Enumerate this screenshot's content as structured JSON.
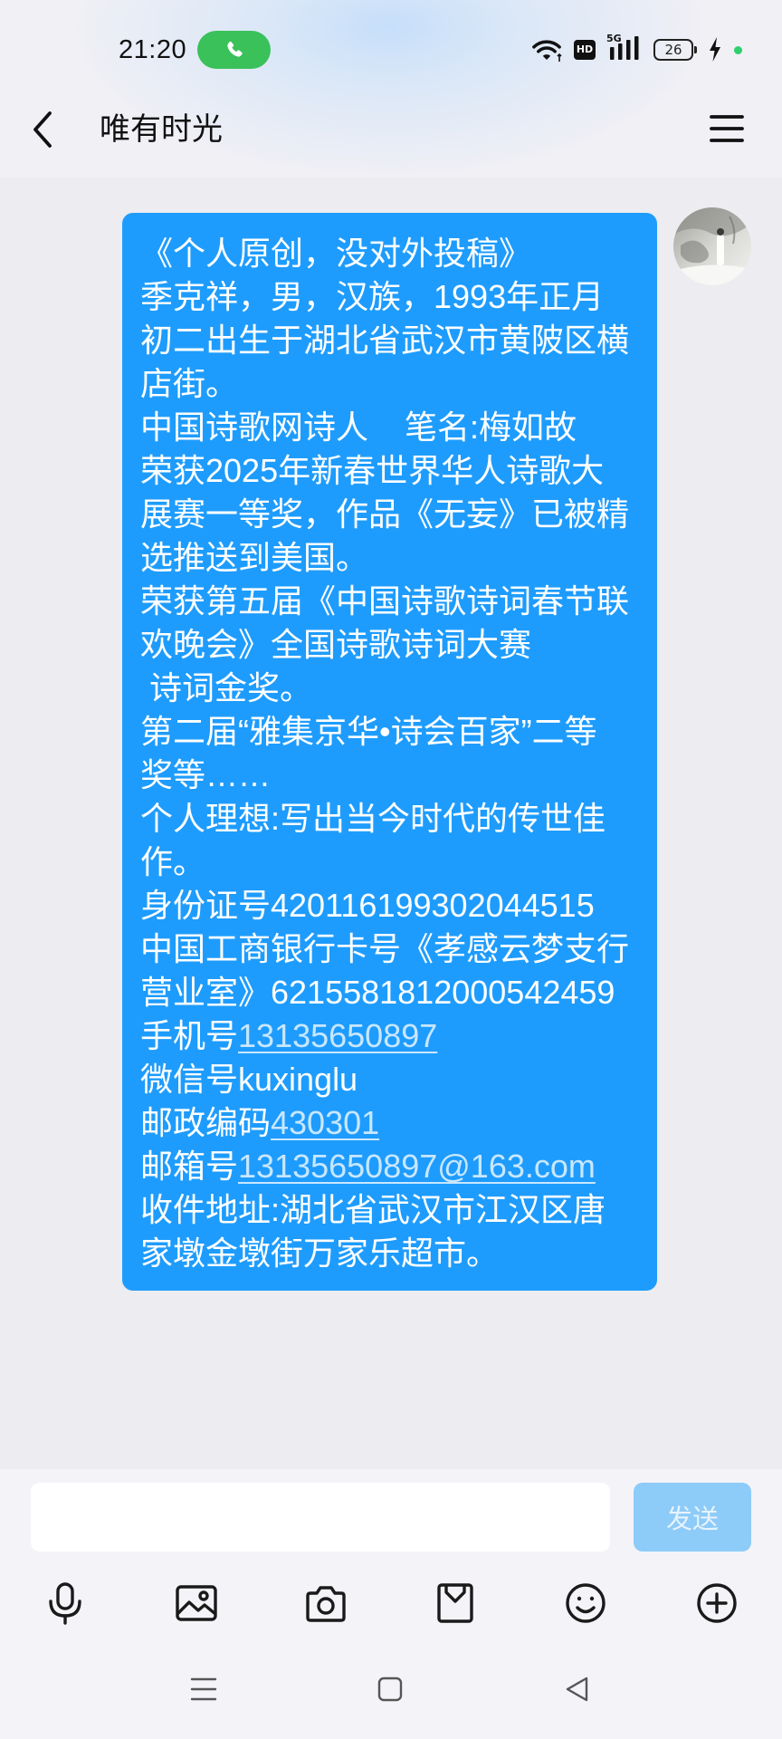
{
  "status_bar": {
    "time": "21:20",
    "call_icon": "phone-icon",
    "wifi_icon": "wifi-icon",
    "hd_label": "HD",
    "network_label": "5G",
    "battery_level": "26",
    "charging_icon": "bolt-icon",
    "call_color": "#3ac15a",
    "dot_color": "#2fd06d"
  },
  "header": {
    "back_icon": "chevron-left-icon",
    "title": "唯有时光",
    "menu_icon": "hamburger-menu-icon"
  },
  "conversation": {
    "messages": [
      {
        "lines": [
          {
            "text": "《个人原创，没对外投稿》"
          },
          {
            "text": "季克祥，男，汉族，1993年正月"
          },
          {
            "text": "初二出生于湖北省武汉市黄陂区横"
          },
          {
            "text": "店街。"
          },
          {
            "text": "中国诗歌网诗人    笔名:梅如故"
          },
          {
            "text": "荣获2025年新春世界华人诗歌大"
          },
          {
            "text": "展赛一等奖，作品《无妄》已被精"
          },
          {
            "text": "选推送到美国。"
          },
          {
            "text": "荣获第五届《中国诗歌诗词春节联"
          },
          {
            "text": "欢晚会》全国诗歌诗词大赛"
          },
          {
            "text": " 诗词金奖。"
          },
          {
            "text": "第二届“雅集京华•诗会百家”二等"
          },
          {
            "text": "奖等……"
          },
          {
            "text": "个人理想:写出当今时代的传世佳"
          },
          {
            "text": "作。"
          },
          {
            "text": "身份证号420116199302044515"
          },
          {
            "text": "中国工商银行卡号《孝感云梦支行"
          },
          {
            "text": "营业室》6215581812000542459"
          },
          {
            "text": "手机号",
            "link": "13135650897"
          },
          {
            "text": "微信号kuxinglu"
          },
          {
            "text": "邮政编码",
            "link": "430301"
          },
          {
            "text": "邮箱号",
            "link": "13135650897@163.com"
          },
          {
            "text": "收件地址:湖北省武汉市江汉区唐"
          },
          {
            "text": "家墩金墩街万家乐超市。"
          }
        ]
      }
    ]
  },
  "composer": {
    "input_value": "",
    "send_label": "发送"
  },
  "toolbar": {
    "items": [
      "microphone-icon",
      "image-icon",
      "camera-icon",
      "red-packet-icon",
      "emoji-icon",
      "plus-circle-icon"
    ]
  },
  "nav_bar": {
    "items": [
      "recent-apps-icon",
      "home-icon",
      "back-triangle-icon"
    ]
  },
  "colors": {
    "bubble": "#1e9cfd",
    "link": "#c8e7ff",
    "send_button_disabled": "#8dcbf8",
    "chat_background": "#edecf1",
    "composer_background": "#f4f3f8"
  }
}
